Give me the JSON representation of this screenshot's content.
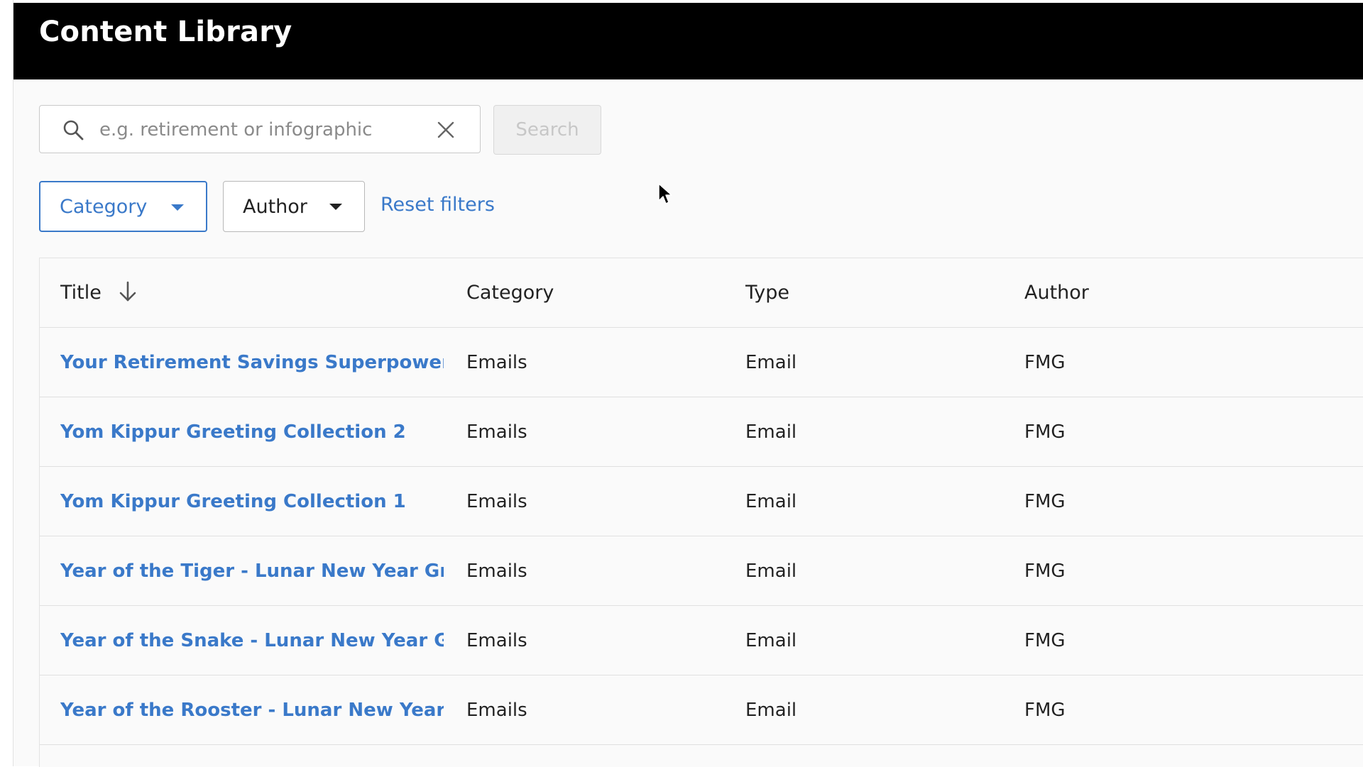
{
  "header": {
    "title": "Content Library"
  },
  "search": {
    "placeholder": "e.g. retirement or infographic",
    "value": "",
    "button_label": "Search"
  },
  "filters": {
    "category_label": "Category",
    "author_label": "Author",
    "reset_label": "Reset filters"
  },
  "table": {
    "columns": {
      "title": "Title",
      "category": "Category",
      "type": "Type",
      "author": "Author"
    },
    "rows": [
      {
        "title": "Your Retirement Savings Superpower",
        "category": "Emails",
        "type": "Email",
        "author": "FMG"
      },
      {
        "title": "Yom Kippur Greeting Collection 2",
        "category": "Emails",
        "type": "Email",
        "author": "FMG"
      },
      {
        "title": "Yom Kippur Greeting Collection 1",
        "category": "Emails",
        "type": "Email",
        "author": "FMG"
      },
      {
        "title": "Year of the Tiger - Lunar New Year Gre...",
        "category": "Emails",
        "type": "Email",
        "author": "FMG"
      },
      {
        "title": "Year of the Snake - Lunar New Year Gr...",
        "category": "Emails",
        "type": "Email",
        "author": "FMG"
      },
      {
        "title": "Year of the Rooster - Lunar New Year ...",
        "category": "Emails",
        "type": "Email",
        "author": "FMG"
      }
    ]
  },
  "icons": {
    "search": "search-icon",
    "clear": "close-icon",
    "dropdown": "caret-down-icon",
    "sort": "arrow-down-icon",
    "cursor": "mouse-pointer-icon"
  },
  "colors": {
    "header_bg": "#000000",
    "accent": "#3a79c9",
    "page_bg": "#fafafa"
  }
}
